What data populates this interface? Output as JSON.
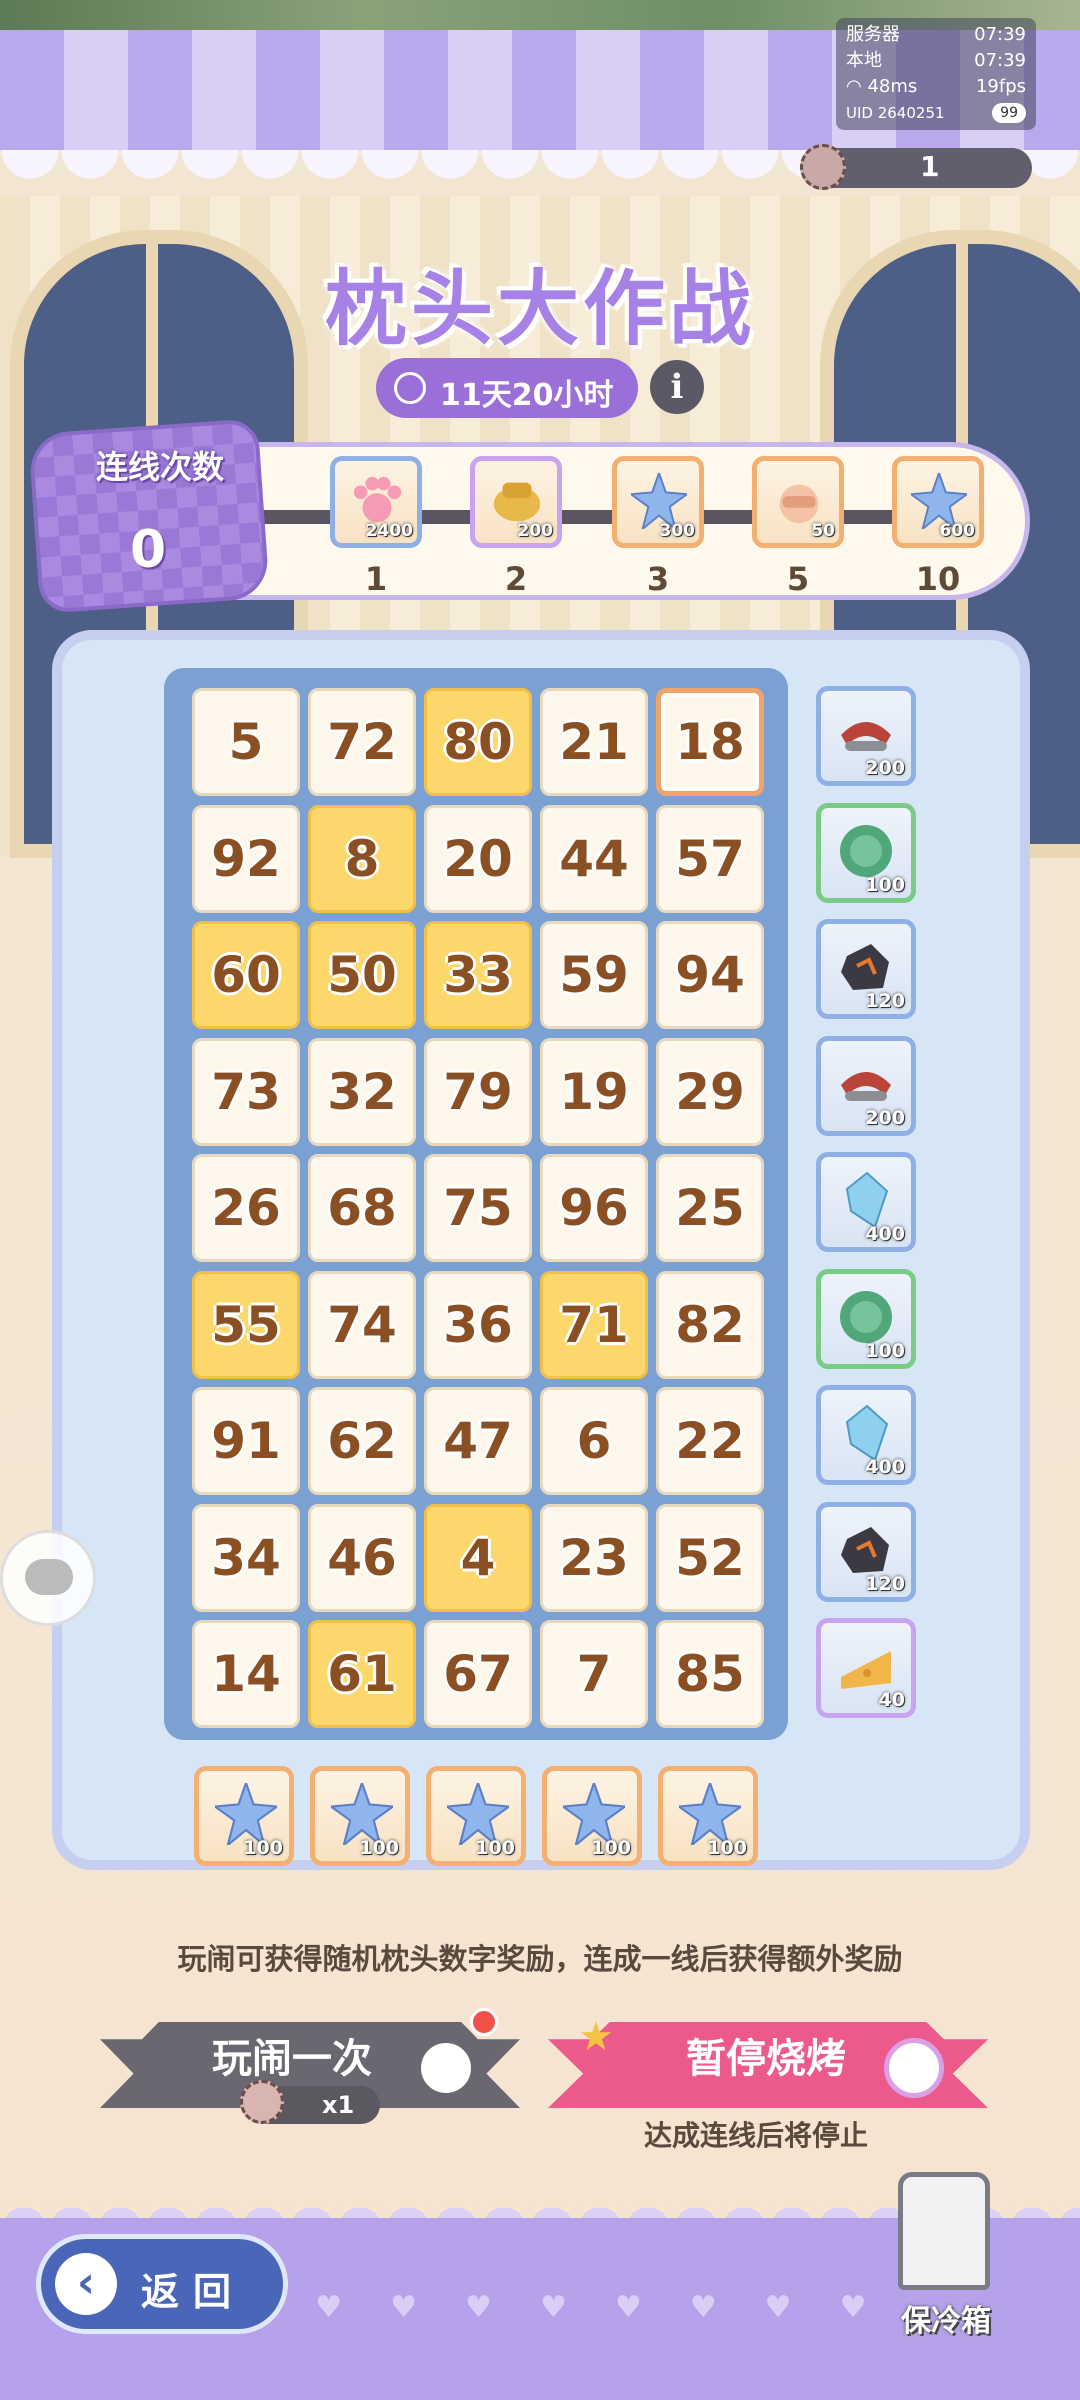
{
  "status": {
    "server_label": "服务器",
    "server_time": "07:39",
    "local_label": "本地",
    "local_time": "07:39",
    "ping": "48ms",
    "fps": "19fps",
    "uid": "UID 2640251",
    "battery": "99"
  },
  "currency": {
    "amount": "1",
    "icon": "pillow-token-icon"
  },
  "event": {
    "title": "枕头大作战",
    "timer": "11天20小时",
    "info_label": "i"
  },
  "lines": {
    "label": "连线次数",
    "count": "0"
  },
  "milestones": [
    {
      "qty": "2400",
      "need": "1",
      "icon": "cat-paw-icon",
      "frame": "blue"
    },
    {
      "qty": "200",
      "need": "2",
      "icon": "gold-bell-icon",
      "frame": "purple"
    },
    {
      "qty": "300",
      "need": "3",
      "icon": "crystal-star-icon",
      "frame": "orange"
    },
    {
      "qty": "50",
      "need": "5",
      "icon": "fist-card-icon",
      "frame": "orange"
    },
    {
      "qty": "600",
      "need": "10",
      "icon": "crystal-star-icon",
      "frame": "orange"
    }
  ],
  "board": {
    "rows": [
      [
        "5",
        "72",
        "80",
        "21",
        "18"
      ],
      [
        "92",
        "8",
        "20",
        "44",
        "57"
      ],
      [
        "60",
        "50",
        "33",
        "59",
        "94"
      ],
      [
        "73",
        "32",
        "79",
        "19",
        "29"
      ],
      [
        "26",
        "68",
        "75",
        "96",
        "25"
      ],
      [
        "55",
        "74",
        "36",
        "71",
        "82"
      ],
      [
        "91",
        "62",
        "47",
        "6",
        "22"
      ],
      [
        "34",
        "46",
        "4",
        "23",
        "52"
      ],
      [
        "14",
        "61",
        "67",
        "7",
        "85"
      ]
    ],
    "hits": [
      [
        0,
        2
      ],
      [
        1,
        1
      ],
      [
        2,
        0
      ],
      [
        2,
        1
      ],
      [
        2,
        2
      ],
      [
        5,
        0
      ],
      [
        5,
        3
      ],
      [
        7,
        2
      ],
      [
        8,
        1
      ]
    ],
    "selected": [
      0,
      4
    ]
  },
  "row_rewards": [
    {
      "qty": "200",
      "icon": "red-scarf-icon",
      "frame": "blue"
    },
    {
      "qty": "100",
      "icon": "green-badge-icon",
      "frame": "green"
    },
    {
      "qty": "120",
      "icon": "lava-ore-icon",
      "frame": "blue"
    },
    {
      "qty": "200",
      "icon": "red-scarf-icon",
      "frame": "blue"
    },
    {
      "qty": "400",
      "icon": "blue-crystal-icon",
      "frame": "blue"
    },
    {
      "qty": "100",
      "icon": "green-badge-icon",
      "frame": "green"
    },
    {
      "qty": "400",
      "icon": "blue-crystal-icon",
      "frame": "blue"
    },
    {
      "qty": "120",
      "icon": "lava-ore-icon",
      "frame": "blue"
    },
    {
      "qty": "40",
      "icon": "cheese-icon",
      "frame": "purple"
    }
  ],
  "column_rewards": [
    {
      "qty": "100",
      "icon": "crystal-star-icon"
    },
    {
      "qty": "100",
      "icon": "crystal-star-icon"
    },
    {
      "qty": "100",
      "icon": "crystal-star-icon"
    },
    {
      "qty": "100",
      "icon": "crystal-star-icon"
    },
    {
      "qty": "100",
      "icon": "crystal-star-icon"
    }
  ],
  "description": "玩闹可获得随机枕头数字奖励，连成一线后获得额外奖励",
  "play_button": {
    "label": "玩闹一次",
    "cost": "x1"
  },
  "pause_button": {
    "label": "暂停烧烤",
    "sub": "达成连线后将停止"
  },
  "back_button": {
    "label": "返回"
  },
  "fridge": {
    "label": "保冷箱"
  },
  "colors": {
    "accent": "#a782e6",
    "hit": "#fbd76c",
    "board": "#7aa1d2",
    "pause": "#ec5a8c"
  }
}
